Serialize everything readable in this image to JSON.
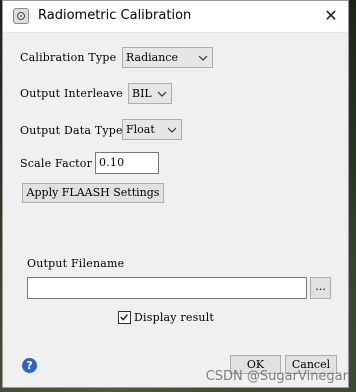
{
  "window": {
    "title": "Radiometric Calibration",
    "close_glyph": "✕",
    "app_icon": "envi-icon"
  },
  "form": {
    "calibration_type": {
      "label": "Calibration Type",
      "value": "Radiance"
    },
    "output_interleave": {
      "label": "Output Interleave",
      "value": "BIL"
    },
    "output_data_type": {
      "label": "Output Data Type",
      "value": "Float"
    },
    "scale_factor": {
      "label": "Scale Factor",
      "value": "0.10"
    },
    "flaash_button": "Apply FLAASH Settings",
    "output_filename": {
      "label": "Output Filename",
      "value": "",
      "browse": "..."
    },
    "display_result": {
      "label": "Display result",
      "checked": true
    }
  },
  "footer": {
    "help_glyph": "?",
    "ok": "OK",
    "cancel": "Cancel"
  },
  "watermark": "CSDN @SugarVinegar"
}
